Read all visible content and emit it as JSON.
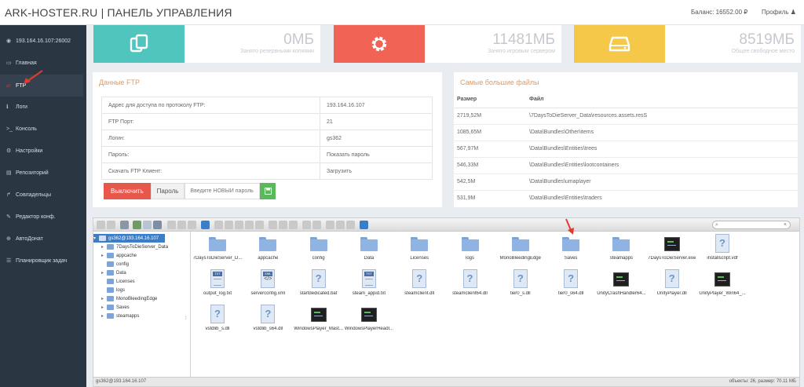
{
  "header": {
    "brand": "ARK-HOSTER.RU | ПАНЕЛЬ УПРАВЛЕНИЯ",
    "balance": "Баланс: 16552.00 ₽",
    "profile": "Профиль ♟"
  },
  "sidebar": {
    "items": [
      {
        "label": "193.164.16.107:26002",
        "icon": "globe-icon"
      },
      {
        "label": "Главная",
        "icon": "monitor-icon"
      },
      {
        "label": "FTP",
        "icon": "folder-icon"
      },
      {
        "label": "Логи",
        "icon": "info-icon"
      },
      {
        "label": "Консоль",
        "icon": "terminal-icon"
      },
      {
        "label": "Настройки",
        "icon": "gears-icon"
      },
      {
        "label": "Репозиторий",
        "icon": "archive-icon"
      },
      {
        "label": "Совладельцы",
        "icon": "share-icon"
      },
      {
        "label": "Редактор конф.",
        "icon": "edit-icon"
      },
      {
        "label": "АвтоДонат",
        "icon": "cart-icon"
      },
      {
        "label": "Планировщик задач",
        "icon": "list-icon"
      }
    ]
  },
  "stats": [
    {
      "value": "0МБ",
      "caption": "Занято резервными копиями",
      "color": "#4fc5be",
      "icon": "copy-icon"
    },
    {
      "value": "11481МБ",
      "caption": "Занято игровым сервером",
      "color": "#f16355",
      "icon": "gear-icon"
    },
    {
      "value": "8519МБ",
      "caption": "Общее свободное место",
      "color": "#f5c84a",
      "icon": "hdd-icon"
    }
  ],
  "ftp": {
    "title": "Данные FTP",
    "rows": [
      {
        "label": "Адрес для доступа по протоколу FTP:",
        "value": "193.164.16.107"
      },
      {
        "label": "FTP Порт:",
        "value": "21"
      },
      {
        "label": "Логин:",
        "value": "gs362"
      },
      {
        "label": "Пароль:",
        "value": "Показать пароль"
      },
      {
        "label": "Скачать FTP Клиент:",
        "value": "Загрузить"
      }
    ],
    "disable_label": "Выключить",
    "password_label": "Пароль",
    "password_placeholder": "Введите НОВЫЙ пароль"
  },
  "largest": {
    "title": "Самые большие файлы",
    "col_size": "Размер",
    "col_file": "Файл",
    "rows": [
      {
        "size": "2719,52M",
        "file": "\\7DaysToDieServer_Data\\resources.assets.resS"
      },
      {
        "size": "1085,65M",
        "file": "\\Data\\Bundles\\Other\\items"
      },
      {
        "size": "567,97M",
        "file": "\\Data\\Bundles\\Entities\\trees"
      },
      {
        "size": "546,33M",
        "file": "\\Data\\Bundles\\Entities\\lootcontainers"
      },
      {
        "size": "542,5M",
        "file": "\\Data\\Bundles\\umaplayer"
      },
      {
        "size": "531,9M",
        "file": "\\Data\\Bundles\\Entities\\traders"
      }
    ]
  },
  "filemanager": {
    "search_icon": "search-icon",
    "tree": {
      "root": "gs362@193.164.16.107",
      "items": [
        "7DaysToDieServer_Data",
        "appcache",
        "config",
        "Data",
        "Licenses",
        "logs",
        "MonoBleedingEdge",
        "Saves",
        "steamapps"
      ]
    },
    "files": [
      {
        "name": "7DaysToDieServer_D...",
        "type": "folder"
      },
      {
        "name": "appcache",
        "type": "folder"
      },
      {
        "name": "config",
        "type": "folder"
      },
      {
        "name": "Data",
        "type": "folder"
      },
      {
        "name": "Licenses",
        "type": "folder"
      },
      {
        "name": "logs",
        "type": "folder"
      },
      {
        "name": "MonoBleedingEdge",
        "type": "folder"
      },
      {
        "name": "Saves",
        "type": "folder"
      },
      {
        "name": "steamapps",
        "type": "folder"
      },
      {
        "name": "7DaysToDieServer.exe",
        "type": "exe"
      },
      {
        "name": "installscript.vdf",
        "type": "unknown"
      },
      {
        "name": "output_log.txt",
        "type": "txt"
      },
      {
        "name": "serverconfig.xml",
        "type": "xml"
      },
      {
        "name": "startdedicated.bat",
        "type": "unknown"
      },
      {
        "name": "steam_appid.txt",
        "type": "txt"
      },
      {
        "name": "steamclient.dll",
        "type": "unknown"
      },
      {
        "name": "steamclient64.dll",
        "type": "unknown"
      },
      {
        "name": "tier0_s.dll",
        "type": "unknown"
      },
      {
        "name": "tier0_s64.dll",
        "type": "unknown"
      },
      {
        "name": "UnityCrashHandler64...",
        "type": "exe"
      },
      {
        "name": "UnityPlayer.dll",
        "type": "unknown"
      },
      {
        "name": "UnityPlayer_Win64_...",
        "type": "exe"
      },
      {
        "name": "vstdlib_s.dll",
        "type": "unknown"
      },
      {
        "name": "vstdlib_s64.dll",
        "type": "unknown"
      },
      {
        "name": "WindowsPlayer_Mast...",
        "type": "exe"
      },
      {
        "name": "WindowsPlayerHeadl...",
        "type": "exe"
      }
    ],
    "status_left": "gs362@193.164.16.107",
    "status_right": "объекты: 26, размер: 70.11 МБ"
  }
}
